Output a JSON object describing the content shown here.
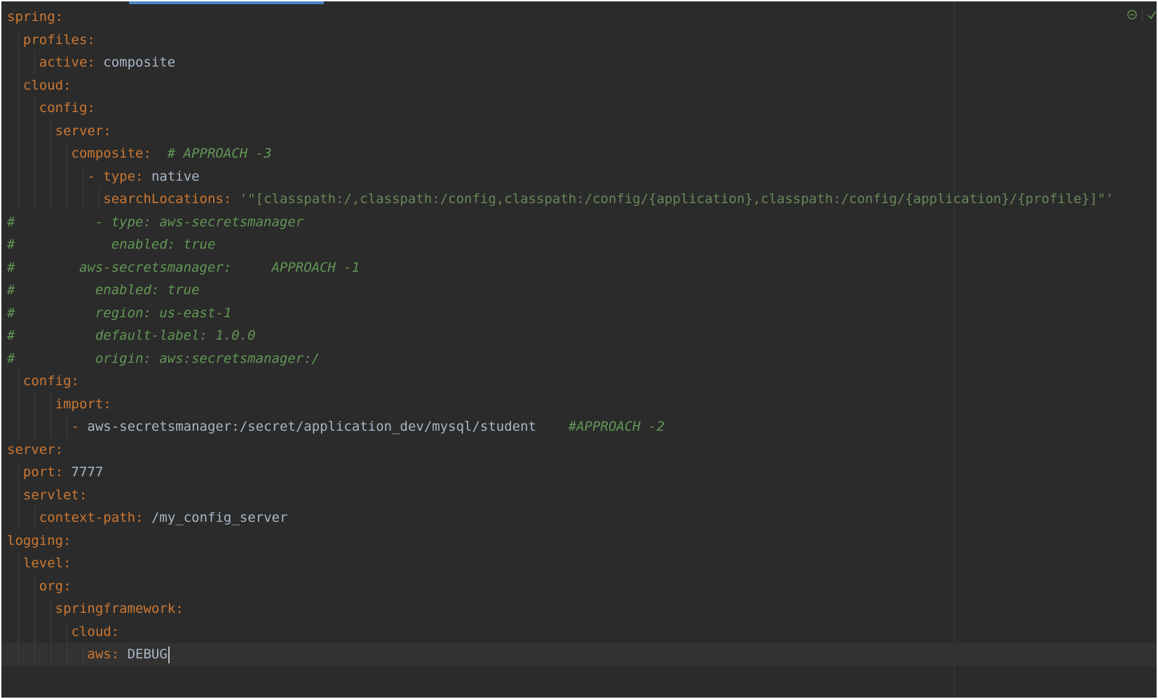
{
  "editor": {
    "lines": [
      {
        "indent": "",
        "key": "spring",
        "colon": ":",
        "value": "",
        "comment": ""
      },
      {
        "indent": "  ",
        "key": "profiles",
        "colon": ":",
        "value": "",
        "comment": ""
      },
      {
        "indent": "    ",
        "key": "active",
        "colon": ":",
        "value": " composite",
        "comment": ""
      },
      {
        "indent": "  ",
        "key": "cloud",
        "colon": ":",
        "value": "",
        "comment": ""
      },
      {
        "indent": "    ",
        "key": "config",
        "colon": ":",
        "value": "",
        "comment": ""
      },
      {
        "indent": "      ",
        "key": "server",
        "colon": ":",
        "value": "",
        "comment": ""
      },
      {
        "indent": "        ",
        "key": "composite",
        "colon": ":",
        "value": "",
        "comment": "  # APPROACH -3"
      },
      {
        "indent": "          ",
        "dash": "- ",
        "key": "type",
        "colon": ":",
        "value": " native",
        "comment": ""
      },
      {
        "indent": "            ",
        "key": "searchLocations",
        "colon": ":",
        "string": " '\"[classpath:/,classpath:/config,classpath:/config/{application},classpath:/config/{application}/{profile}]\"'",
        "comment": ""
      },
      {
        "comment_full": "#          - type: aws-secretsmanager"
      },
      {
        "comment_full": "#            enabled: true"
      },
      {
        "comment_full": "#        aws-secretsmanager:     APPROACH -1"
      },
      {
        "comment_full": "#          enabled: true"
      },
      {
        "comment_full": "#          region: us-east-1"
      },
      {
        "comment_full": "#          default-label: 1.0.0"
      },
      {
        "comment_full": "#          origin: aws:secretsmanager:/"
      },
      {
        "indent": "  ",
        "key": "config",
        "colon": ":",
        "value": "",
        "comment": ""
      },
      {
        "indent": "      ",
        "key": "import",
        "colon": ":",
        "value": "",
        "comment": ""
      },
      {
        "indent": "        ",
        "dash": "- ",
        "key": "",
        "colon": "",
        "value": "aws-secretsmanager:/secret/application_dev/mysql/student",
        "comment": "    #APPROACH -2"
      },
      {
        "indent": "",
        "key": "server",
        "colon": ":",
        "value": "",
        "comment": ""
      },
      {
        "indent": "  ",
        "key": "port",
        "colon": ":",
        "value": " 7777",
        "comment": ""
      },
      {
        "indent": "  ",
        "key": "servlet",
        "colon": ":",
        "value": "",
        "comment": ""
      },
      {
        "indent": "    ",
        "key": "context-path",
        "colon": ":",
        "value": " /my_config_server",
        "comment": ""
      },
      {
        "indent": "",
        "key": "logging",
        "colon": ":",
        "value": "",
        "comment": ""
      },
      {
        "indent": "  ",
        "key": "level",
        "colon": ":",
        "value": "",
        "comment": ""
      },
      {
        "indent": "    ",
        "key": "org",
        "colon": ":",
        "value": "",
        "comment": ""
      },
      {
        "indent": "      ",
        "key": "springframework",
        "colon": ":",
        "value": "",
        "comment": ""
      },
      {
        "indent": "        ",
        "key": "cloud",
        "colon": ":",
        "value": "",
        "comment": ""
      },
      {
        "indent": "          ",
        "key": "aws",
        "colon": ":",
        "value": " DEBUG",
        "comment": "",
        "current": true
      }
    ]
  },
  "status": {
    "inspection_icon": "no-problems-icon",
    "check_icon": "check-icon",
    "accent_color": "#6a8759"
  },
  "colors": {
    "background": "#2b2b2b",
    "key": "#cc7832",
    "value": "#a9b7c6",
    "string": "#6a8759",
    "comment": "#629755"
  }
}
